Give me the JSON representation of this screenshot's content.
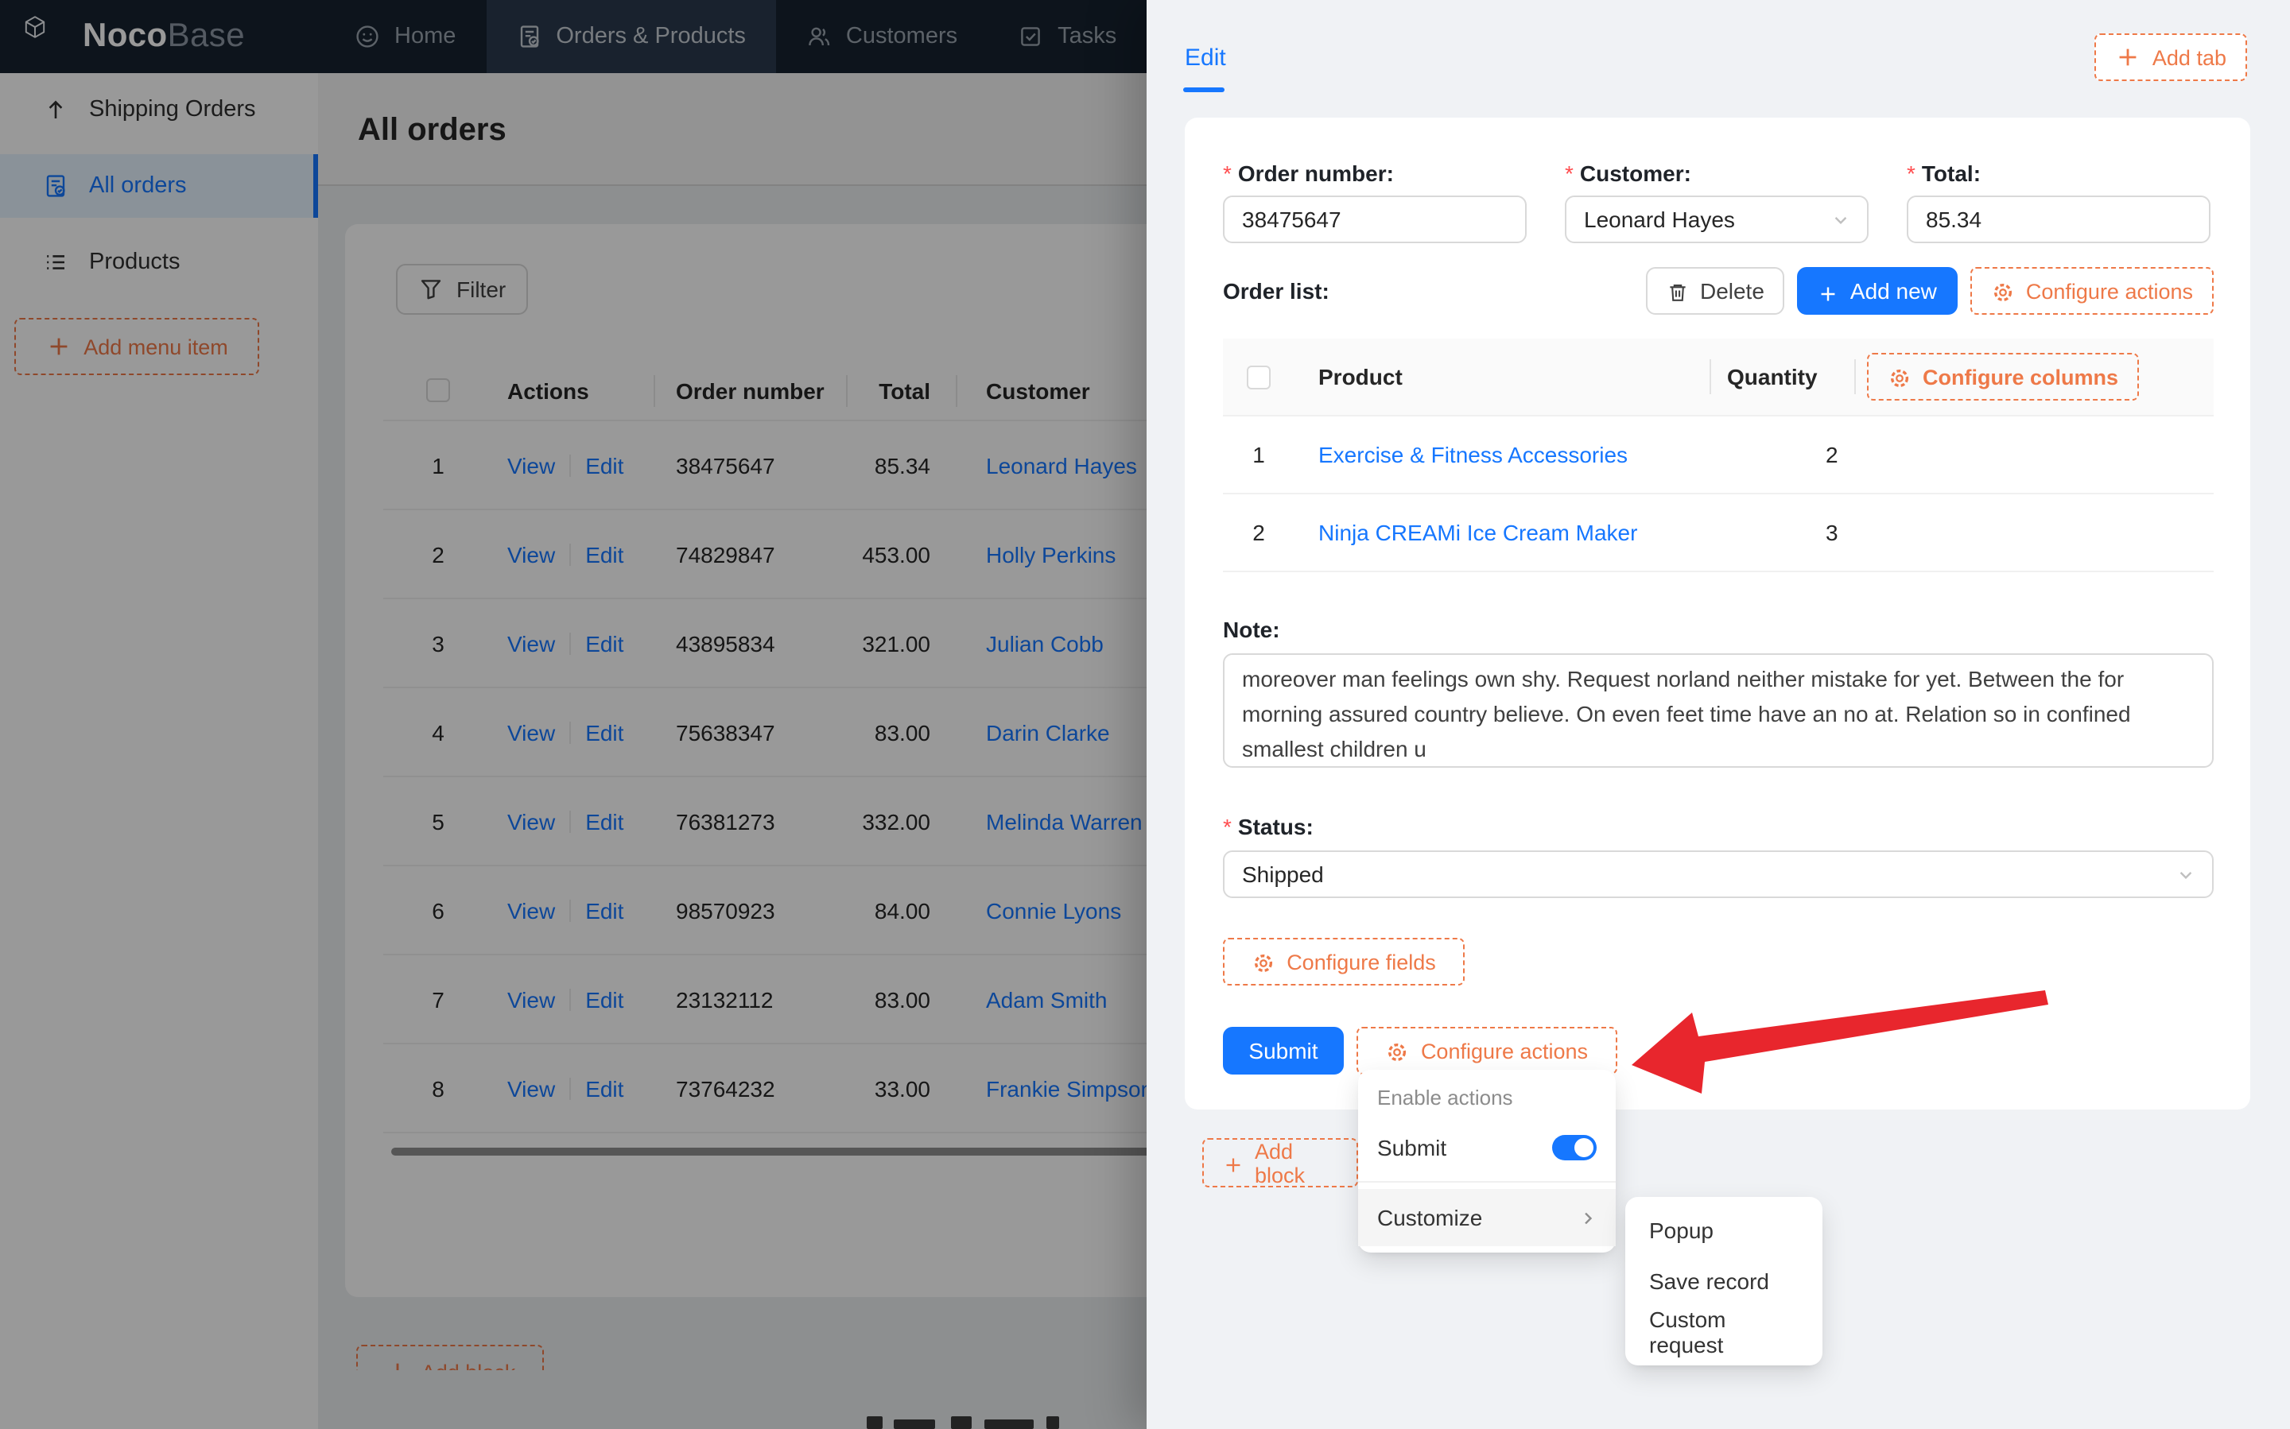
{
  "brand": {
    "primary": "Noco",
    "secondary": "Base"
  },
  "nav": {
    "items": [
      {
        "label": "Home",
        "icon": "home-icon",
        "active": false
      },
      {
        "label": "Orders & Products",
        "icon": "orders-icon",
        "active": true
      },
      {
        "label": "Customers",
        "icon": "customers-icon",
        "active": false
      },
      {
        "label": "Tasks",
        "icon": "tasks-icon",
        "active": false
      }
    ]
  },
  "sidebar": {
    "items": [
      {
        "label": "Shipping Orders",
        "icon": "arrow-up-icon",
        "active": false
      },
      {
        "label": "All orders",
        "icon": "file-check-icon",
        "active": true
      },
      {
        "label": "Products",
        "icon": "list-icon",
        "active": false
      }
    ],
    "add_menu_item": "Add menu item"
  },
  "main": {
    "title": "All orders",
    "filter_label": "Filter",
    "add_block_label": "Add block",
    "table": {
      "action_labels": [
        "View",
        "Edit"
      ],
      "headers": {
        "actions": "Actions",
        "order_number": "Order number",
        "total": "Total",
        "customer": "Customer"
      },
      "rows": [
        {
          "index": "1",
          "order_number": "38475647",
          "total": "85.34",
          "customer": "Leonard Hayes"
        },
        {
          "index": "2",
          "order_number": "74829847",
          "total": "453.00",
          "customer": "Holly Perkins"
        },
        {
          "index": "3",
          "order_number": "43895834",
          "total": "321.00",
          "customer": "Julian Cobb"
        },
        {
          "index": "4",
          "order_number": "75638347",
          "total": "83.00",
          "customer": "Darin Clarke"
        },
        {
          "index": "5",
          "order_number": "76381273",
          "total": "332.00",
          "customer": "Melinda Warren"
        },
        {
          "index": "6",
          "order_number": "98570923",
          "total": "84.00",
          "customer": "Connie Lyons"
        },
        {
          "index": "7",
          "order_number": "23132112",
          "total": "83.00",
          "customer": "Adam Smith"
        },
        {
          "index": "8",
          "order_number": "73764232",
          "total": "33.00",
          "customer": "Frankie Simpson"
        }
      ]
    }
  },
  "drawer": {
    "tab_label": "Edit",
    "add_tab_label": "Add tab",
    "add_block_label": "Add block",
    "form": {
      "order_number": {
        "label": "Order number:",
        "value": "38475647"
      },
      "customer": {
        "label": "Customer:",
        "value": "Leonard Hayes"
      },
      "total": {
        "label": "Total:",
        "value": "85.34"
      },
      "order_list_label": "Order list:",
      "delete_label": "Delete",
      "add_new_label": "Add new",
      "configure_actions_label": "Configure actions",
      "subtable": {
        "product_header": "Product",
        "quantity_header": "Quantity",
        "configure_columns_label": "Configure columns",
        "rows": [
          {
            "index": "1",
            "product": "Exercise & Fitness Accessories",
            "quantity": "2"
          },
          {
            "index": "2",
            "product": "Ninja CREAMi Ice Cream Maker",
            "quantity": "3"
          }
        ]
      },
      "note": {
        "label": "Note:",
        "value": "moreover man feelings own shy. Request norland neither mistake for yet. Between the for morning assured country believe. On even feet time have an no at. Relation so in confined smallest children u"
      },
      "status": {
        "label": "Status:",
        "value": "Shipped"
      },
      "configure_fields_label": "Configure fields",
      "submit_label": "Submit"
    },
    "actions_menu": {
      "group_label": "Enable actions",
      "items": [
        {
          "label": "Submit",
          "enabled": true
        }
      ],
      "customize_label": "Customize"
    },
    "customize_submenu": [
      "Popup",
      "Save record",
      "Custom request"
    ]
  },
  "colors": {
    "accent_blue": "#1677ff",
    "designer_orange": "#ee7948",
    "arrow_red": "#e8262d",
    "header_dark": "#16222f"
  }
}
